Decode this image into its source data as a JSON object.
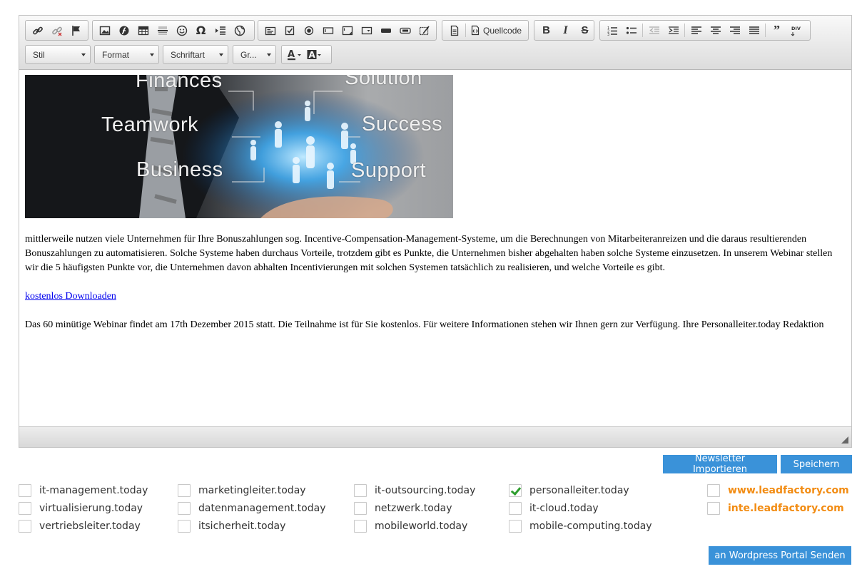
{
  "toolbar": {
    "quellcode_label": "Quellcode",
    "combos": [
      "Stil",
      "Format",
      "Schriftart",
      "Gr..."
    ]
  },
  "content": {
    "hero_words": {
      "finances": "Finances",
      "solution": "Solution",
      "teamwork": "Teamwork",
      "success": "Success",
      "business": "Business",
      "support": "Support"
    },
    "paragraph1": "mittlerweile nutzen viele Unternehmen für Ihre Bonuszahlungen sog. Incentive-Compensation-Management-Systeme, um die Berechnungen von Mitarbeiteranreizen und die daraus resultierenden Bonuszahlungen zu automatisieren. Solche Systeme haben durchaus Vorteile, trotzdem gibt es Punkte, die Unternehmen bisher abgehalten haben solche Systeme einzusetzen. In unserem Webinar stellen wir die 5 häufigsten Punkte vor, die Unternehmen davon abhalten Incentivierungen mit solchen Systemen tatsächlich zu realisieren, und welche Vorteile es gibt.",
    "link": "kostenlos Downloaden",
    "paragraph2": "Das 60 minütige Webinar findet am 17th Dezember 2015 statt. Die Teilnahme ist für Sie kostenlos. Für weitere Informationen stehen wir Ihnen gern zur Verfügung. Ihre Personalleiter.today Redaktion"
  },
  "buttons": {
    "import": "Newsletter Importieren",
    "save": "Speichern",
    "wordpress": "an Wordpress Portal Senden"
  },
  "portals": [
    {
      "label": "it-management.today",
      "checked": false
    },
    {
      "label": "marketingleiter.today",
      "checked": false
    },
    {
      "label": "it-outsourcing.today",
      "checked": false
    },
    {
      "label": "personalleiter.today",
      "checked": true
    },
    {
      "label": "www.leadfactory.com",
      "checked": false
    },
    {
      "label": "virtualisierung.today",
      "checked": false
    },
    {
      "label": "datenmanagement.today",
      "checked": false
    },
    {
      "label": "netzwerk.today",
      "checked": false
    },
    {
      "label": "it-cloud.today",
      "checked": false
    },
    {
      "label": "inte.leadfactory.com",
      "checked": false
    },
    {
      "label": "vertriebsleiter.today",
      "checked": false
    },
    {
      "label": "itsicherheit.today",
      "checked": false
    },
    {
      "label": "mobileworld.today",
      "checked": false
    },
    {
      "label": "mobile-computing.today",
      "checked": false
    }
  ],
  "colors": {
    "accent_button": "#3a92d9",
    "leadfactory_orange": "#f28c13",
    "check_green": "#2e9e2e"
  }
}
